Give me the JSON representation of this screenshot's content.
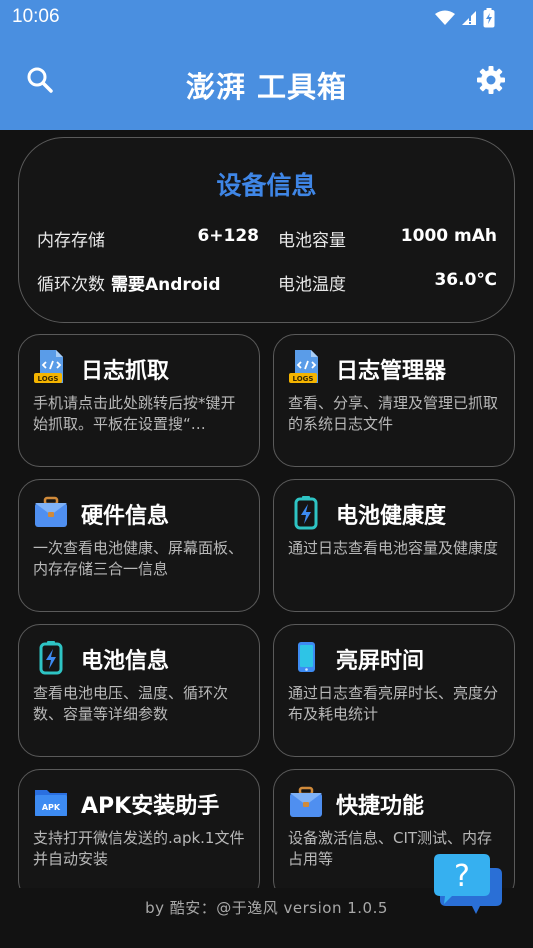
{
  "status_bar": {
    "time": "10:06"
  },
  "toolbar": {
    "title": "澎湃 工具箱",
    "search_icon": "search-icon",
    "settings_icon": "gear-icon"
  },
  "device_info": {
    "title": "设备信息",
    "rows": [
      {
        "label": "内存存储",
        "value": "6+128"
      },
      {
        "label": "电池容量",
        "value": "1000 mAh"
      },
      {
        "label": "循环次数",
        "value": "需要Android"
      },
      {
        "label": "电池温度",
        "value": "36.0℃"
      }
    ]
  },
  "tools": [
    {
      "title": "日志抓取",
      "desc": "手机请点击此处跳转后按*键开始抓取。平板在设置搜“…",
      "icon": "logs-file-icon"
    },
    {
      "title": "日志管理器",
      "desc": "查看、分享、清理及管理已抓取的系统日志文件",
      "icon": "logs-file-icon"
    },
    {
      "title": "硬件信息",
      "desc": "一次查看电池健康、屏幕面板、内存存储三合一信息",
      "icon": "toolbox-icon"
    },
    {
      "title": "电池健康度",
      "desc": "通过日志查看电池容量及健康度",
      "icon": "battery-icon"
    },
    {
      "title": "电池信息",
      "desc": "查看电池电压、温度、循环次数、容量等详细参数",
      "icon": "battery-icon"
    },
    {
      "title": "亮屏时间",
      "desc": "通过日志查看亮屏时长、亮度分布及耗电统计",
      "icon": "phone-icon"
    },
    {
      "title": "APK安装助手",
      "desc": "支持打开微信发送的.apk.1文件并自动安装",
      "icon": "apk-folder-icon"
    },
    {
      "title": "快捷功能",
      "desc": "设备激活信息、CIT测试、内存占用等",
      "icon": "toolbox-icon"
    }
  ],
  "footer": {
    "text": "by 酷安：@于逸风 version 1.0.5"
  },
  "help_button": {
    "icon": "help-question-icon"
  },
  "colors": {
    "header": "#4a8fe0",
    "accent": "#3f86e6",
    "background": "#121212"
  }
}
